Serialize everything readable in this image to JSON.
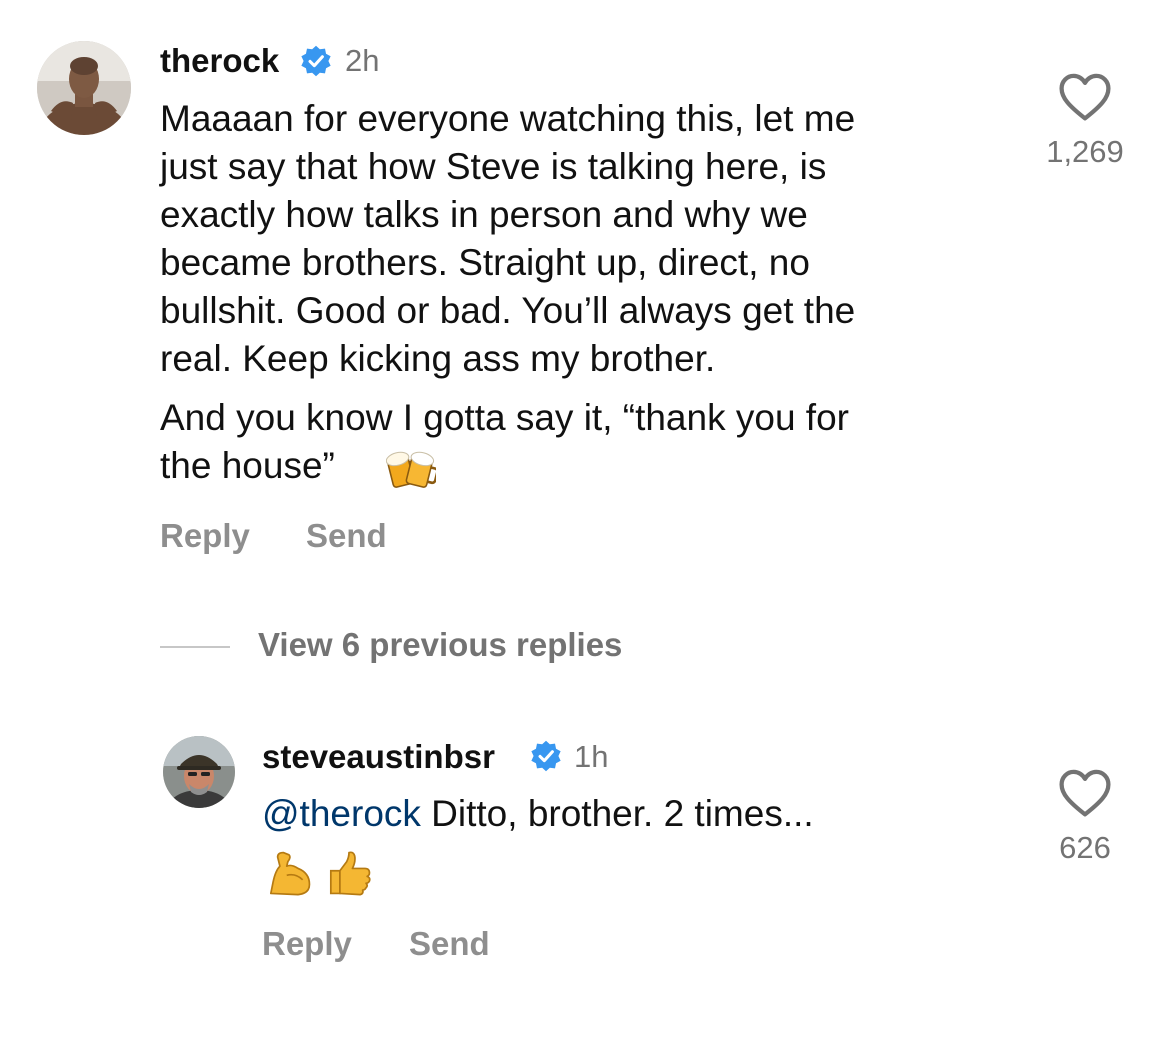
{
  "comment": {
    "username": "therock",
    "verified_icon": "verified-badge-icon",
    "time": "2h",
    "paragraph1": "Maaaan for everyone watching this, let me\njust say that how Steve is talking here, is\nexactly how talks in person and why we\nbecame brothers. Straight up, direct, no\nbullshit. Good or bad. You’ll always get the\nreal. Keep kicking ass my brother.",
    "paragraph2": "And you know I gotta say it, “thank you for\nthe house”",
    "emoji": "beer-mugs-emoji",
    "reply_label": "Reply",
    "send_label": "Send",
    "like_icon": "heart-icon",
    "like_count": "1,269"
  },
  "view_replies_label": "View 6 previous replies",
  "reply": {
    "username": "steveaustinbsr",
    "verified_icon": "verified-badge-icon",
    "time": "1h",
    "mention": "@therock",
    "text": " Ditto, brother. 2 times...",
    "emojis": [
      "flexed-biceps-emoji",
      "thumbs-up-emoji"
    ],
    "reply_label": "Reply",
    "send_label": "Send",
    "like_icon": "heart-icon",
    "like_count": "626"
  },
  "colors": {
    "text": "#111111",
    "secondary": "#737373",
    "action": "#8e8e8e",
    "verified": "#3897f0",
    "mention": "#00376b"
  }
}
